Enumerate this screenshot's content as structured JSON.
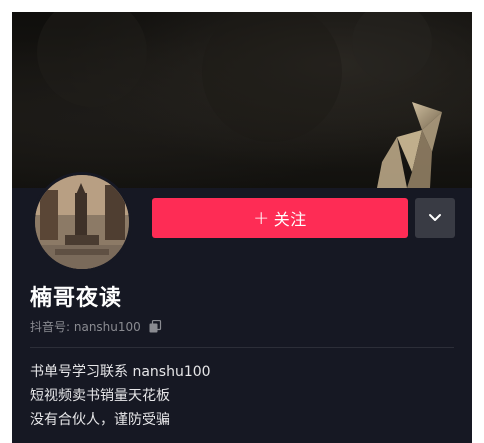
{
  "profile": {
    "follow_label": "关注",
    "follow_plus": "+",
    "nickname": "楠哥夜读",
    "douyin_id_label": "抖音号: nanshu100",
    "bio_lines": [
      "书单号学习联系 nanshu100",
      "短视频卖书销量天花板",
      "没有合伙人，谨防受骗"
    ]
  },
  "colors": {
    "background": "#161823",
    "follow_button": "#fe2c55",
    "more_button": "#393b44"
  },
  "icons": {
    "more": "chevron-down-icon",
    "copy": "copy-icon"
  }
}
